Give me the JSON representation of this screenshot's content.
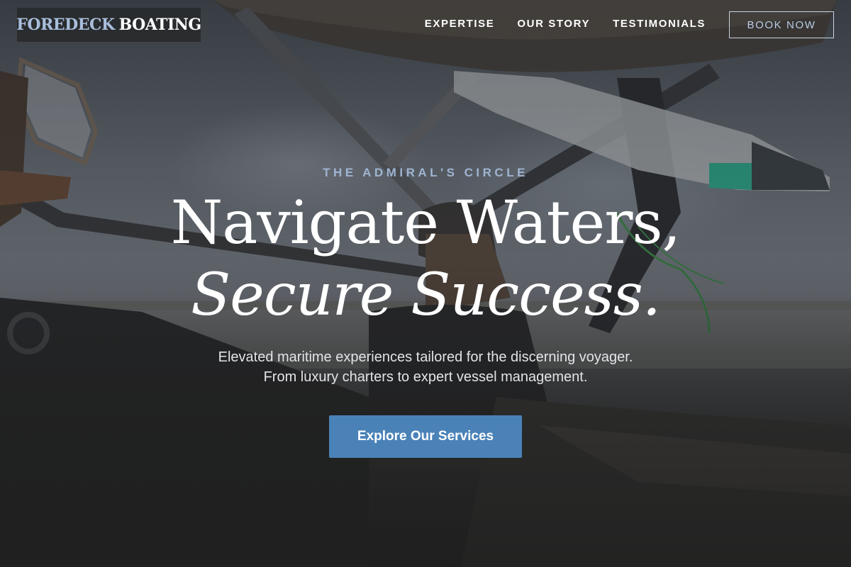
{
  "brand": {
    "logo_primary": "FOREDECK",
    "logo_secondary": "BOATING",
    "logo_primary_color": "#a9bedc"
  },
  "nav": {
    "items": [
      "EXPERTISE",
      "OUR STORY",
      "TESTIMONIALS"
    ],
    "book_label": "BOOK NOW"
  },
  "hero": {
    "eyebrow": "THE ADMIRAL'S CIRCLE",
    "headline_line1": "Navigate Waters,",
    "headline_line2": "Secure Success.",
    "subtitle_line1": "Elevated maritime experiences tailored for the discerning voyager.",
    "subtitle_line2": "From luxury charters to expert vessel management.",
    "cta_label": "Explore Our Services",
    "background_image": "boat-wakeboard-tower-photo"
  },
  "colors": {
    "accent": "#4a82b8",
    "eyebrow": "#9fb4d2"
  }
}
